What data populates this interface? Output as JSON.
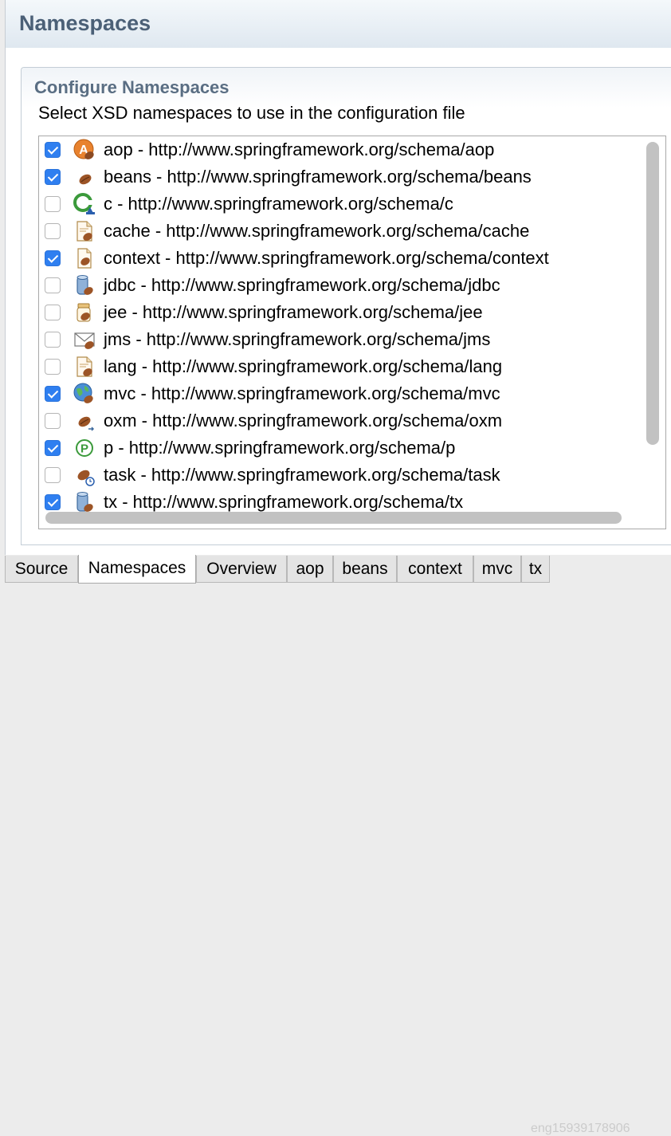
{
  "header": {
    "title": "Namespaces"
  },
  "section": {
    "title": "Configure Namespaces",
    "description": "Select XSD namespaces to use in the configuration file"
  },
  "namespaces": [
    {
      "label": "aop - http://www.springframework.org/schema/aop",
      "checked": true,
      "icon": "aop-icon"
    },
    {
      "label": "beans - http://www.springframework.org/schema/beans",
      "checked": true,
      "icon": "bean-icon"
    },
    {
      "label": "c - http://www.springframework.org/schema/c",
      "checked": false,
      "icon": "c-namespace-icon"
    },
    {
      "label": "cache - http://www.springframework.org/schema/cache",
      "checked": false,
      "icon": "cache-icon"
    },
    {
      "label": "context - http://www.springframework.org/schema/context",
      "checked": true,
      "icon": "context-icon"
    },
    {
      "label": "jdbc - http://www.springframework.org/schema/jdbc",
      "checked": false,
      "icon": "jdbc-icon"
    },
    {
      "label": "jee - http://www.springframework.org/schema/jee",
      "checked": false,
      "icon": "jee-icon"
    },
    {
      "label": "jms - http://www.springframework.org/schema/jms",
      "checked": false,
      "icon": "jms-icon"
    },
    {
      "label": "lang - http://www.springframework.org/schema/lang",
      "checked": false,
      "icon": "lang-icon"
    },
    {
      "label": "mvc - http://www.springframework.org/schema/mvc",
      "checked": true,
      "icon": "mvc-icon"
    },
    {
      "label": "oxm - http://www.springframework.org/schema/oxm",
      "checked": false,
      "icon": "oxm-icon"
    },
    {
      "label": "p - http://www.springframework.org/schema/p",
      "checked": true,
      "icon": "p-namespace-icon"
    },
    {
      "label": "task - http://www.springframework.org/schema/task",
      "checked": false,
      "icon": "task-icon"
    },
    {
      "label": "tx - http://www.springframework.org/schema/tx",
      "checked": true,
      "icon": "tx-icon"
    }
  ],
  "tabs": [
    {
      "label": "Source",
      "active": false
    },
    {
      "label": "Namespaces",
      "active": true
    },
    {
      "label": "Overview",
      "active": false
    },
    {
      "label": "aop",
      "active": false
    },
    {
      "label": "beans",
      "active": false
    },
    {
      "label": "context",
      "active": false
    },
    {
      "label": "mvc",
      "active": false
    },
    {
      "label": "tx",
      "active": false
    }
  ],
  "watermark": "eng15939178906",
  "colors": {
    "header_title": "#4b6077",
    "section_title": "#5a6e83",
    "checkbox_checked": "#2f7ff0",
    "bean_brown": "#a0522d"
  }
}
